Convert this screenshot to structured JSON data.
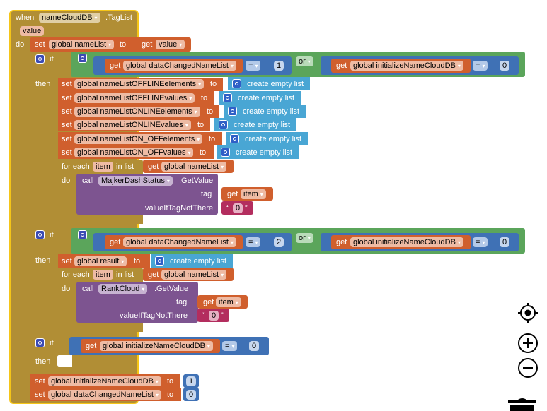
{
  "event": {
    "when_label": "when",
    "component": "nameCloudDB",
    "event_name": ".TagList",
    "param": "value",
    "do_label": "do"
  },
  "set_namelist": {
    "set_label": "set",
    "var": "global nameList",
    "to_label": "to",
    "get_label": "get",
    "value": "value"
  },
  "if1": {
    "if_label": "if",
    "then_label": "then",
    "get_label": "get",
    "left_var": "global dataChangedNameList",
    "op": "=",
    "left_num": "1",
    "or_label": "or",
    "right_var": "global initializeNameCloudDB",
    "right_num": "0",
    "sets": [
      {
        "var": "global nameListOFFLINEelements",
        "value": "create empty list"
      },
      {
        "var": "global nameListOFFLINEvalues",
        "value": "create empty list"
      },
      {
        "var": "global nameListONLINEelements",
        "value": "create empty list"
      },
      {
        "var": "global nameListONLINEvalues",
        "value": "create empty list"
      },
      {
        "var": "global nameListON_OFFelements",
        "value": "create empty list"
      },
      {
        "var": "global nameListON_OFFvalues",
        "value": "create empty list"
      }
    ],
    "set_label": "set",
    "to_label": "to",
    "foreach": {
      "for_each_label": "for each",
      "item": "item",
      "in_list_label": "in list",
      "list_var": "global nameList",
      "do_label": "do",
      "call_label": "call",
      "component": "MajkerDashStatus",
      "method": ".GetValue",
      "tag_label": "tag",
      "tag_value": "item",
      "default_label": "valueIfTagNotThere",
      "default_value": "0"
    }
  },
  "if2": {
    "if_label": "if",
    "then_label": "then",
    "get_label": "get",
    "left_var": "global dataChangedNameList",
    "op": "=",
    "left_num": "2",
    "or_label": "or",
    "right_var": "global initializeNameCloudDB",
    "right_num": "0",
    "set_var": "global result",
    "set_value": "create empty list",
    "foreach": {
      "for_each_label": "for each",
      "item": "item",
      "in_list_label": "in list",
      "list_var": "global nameList",
      "do_label": "do",
      "call_label": "call",
      "component": "RankCloud",
      "method": ".GetValue",
      "tag_label": "tag",
      "tag_value": "item",
      "default_label": "valueIfTagNotThere",
      "default_value": "0"
    }
  },
  "if3": {
    "if_label": "if",
    "then_label": "then",
    "get_label": "get",
    "var": "global initializeNameCloudDB",
    "op": "=",
    "num": "0"
  },
  "final_sets": [
    {
      "set_label": "set",
      "var": "global initializeNameCloudDB",
      "to_label": "to",
      "value": "1"
    },
    {
      "set_label": "set",
      "var": "global dataChangedNameList",
      "to_label": "to",
      "value": "0"
    }
  ],
  "workspace_controls": {
    "recenter": "target-icon",
    "zoom_in": "zoom-in-icon",
    "zoom_out": "zoom-out-icon",
    "trash": "trash-icon"
  }
}
